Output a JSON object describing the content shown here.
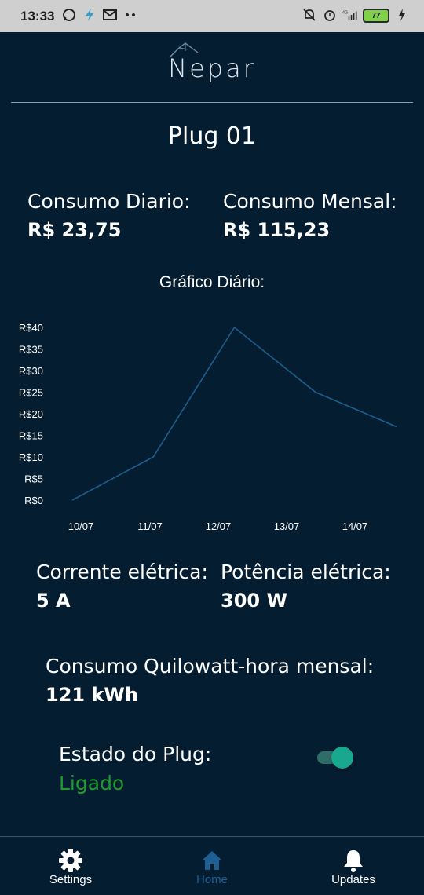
{
  "status_bar": {
    "time": "13:33",
    "battery": "77",
    "network": "4G"
  },
  "header": {
    "logo_text": "Nepar"
  },
  "page": {
    "title": "Plug 01"
  },
  "consumo": {
    "diario_label": "Consumo Diario:",
    "diario_value": "R$ 23,75",
    "mensal_label": "Consumo Mensal:",
    "mensal_value": "R$ 115,23"
  },
  "chart_title": "Gráfico Diário:",
  "chart_data": {
    "type": "line",
    "categories": [
      "10/07",
      "11/07",
      "12/07",
      "13/07",
      "14/07"
    ],
    "x_labels": [
      "10/07",
      "11/07",
      "12/07",
      "13/07",
      "14/07"
    ],
    "y_ticks": [
      "R$0",
      "R$5",
      "R$10",
      "R$15",
      "R$20",
      "R$25",
      "R$30",
      "R$35",
      "R$40"
    ],
    "series": [
      {
        "values": [
          0,
          10,
          40,
          25,
          17
        ],
        "color": "#1c5f8e"
      }
    ],
    "ylim": [
      0,
      40
    ],
    "grid": false,
    "legend": "none"
  },
  "metrics": {
    "corrente_label": "Corrente elétrica:",
    "corrente_value": "5 A",
    "potencia_label": "Potência elétrica:",
    "potencia_value": "300 W",
    "kwh_label": "Consumo Quilowatt-hora mensal:",
    "kwh_value": "121 kWh"
  },
  "plug_state": {
    "label": "Estado do Plug:",
    "status": "Ligado",
    "on": true,
    "status_color": "#1e9b2f"
  },
  "bottom_nav": {
    "items": [
      {
        "label": "Settings",
        "icon": "gear-icon",
        "active": false
      },
      {
        "label": "Home",
        "icon": "home-icon",
        "active": true
      },
      {
        "label": "Updates",
        "icon": "bell-icon",
        "active": false
      }
    ],
    "active_color": "#1d5f93"
  }
}
